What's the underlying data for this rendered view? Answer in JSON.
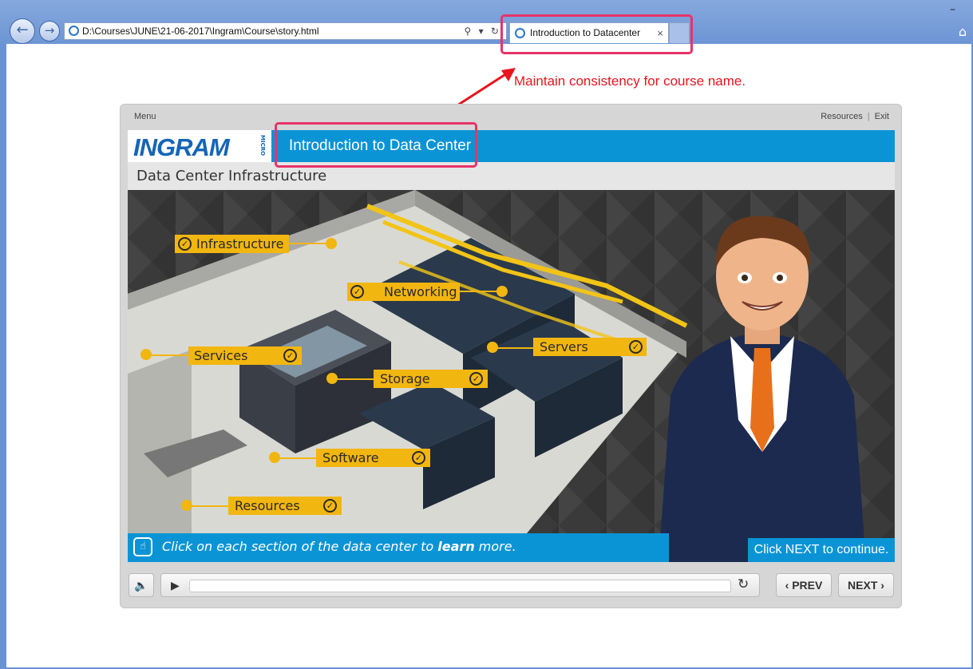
{
  "browser": {
    "address": "D:\\Courses\\JUNE\\21-06-2017\\Ingram\\Course\\story.html",
    "tab_title": "Introduction to Datacenter",
    "tab_close": "×",
    "minimize": "–"
  },
  "annotation": {
    "note": "Maintain consistency for course name.",
    "color": "#e8141e",
    "box_color": "#e8336a"
  },
  "player": {
    "menu_label": "Menu",
    "resources_label": "Resources",
    "exit_label": "Exit",
    "logo_text": "INGRAM",
    "logo_micro": "MICRO",
    "course_title": "Introduction to Data Center",
    "slide_title": "Data Center Infrastructure",
    "hotspots": {
      "infrastructure": "Infrastructure",
      "networking": "Networking",
      "services": "Services",
      "servers": "Servers",
      "storage": "Storage",
      "software": "Software",
      "resources": "Resources"
    },
    "instruction_pre": "Click on each section of the data center to ",
    "instruction_bold": "learn",
    "instruction_post": " more.",
    "next_hint_pre": "Click ",
    "next_hint_bold": "NEXT",
    "next_hint_post": " to continue.",
    "prev_label": "PREV",
    "next_label": "NEXT",
    "accent_blue": "#0a94d6",
    "hotspot_yellow": "#f2b610"
  }
}
